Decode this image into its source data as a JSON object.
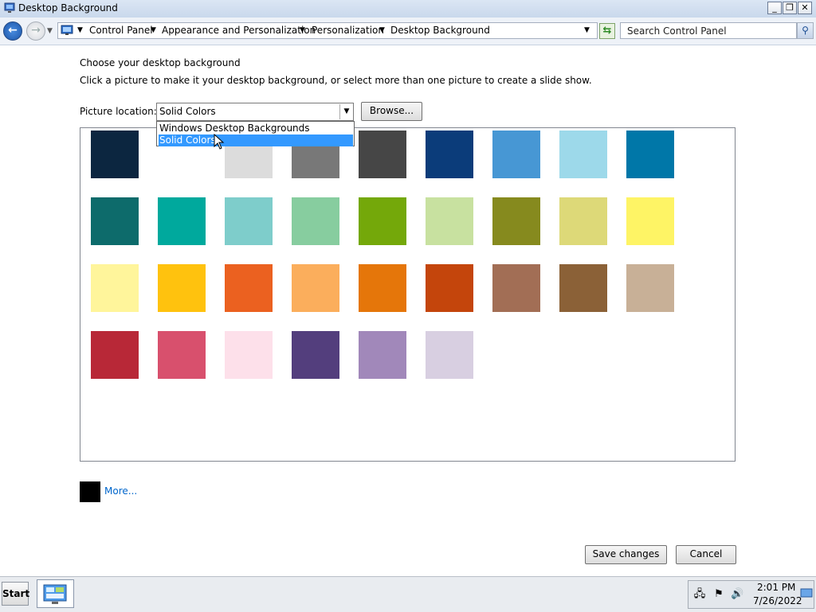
{
  "window": {
    "title": "Desktop Background",
    "controls": {
      "minimize": "_",
      "maximize": "❐",
      "close": "✕"
    }
  },
  "address": {
    "breadcrumbs": [
      "Control Panel",
      "Appearance and Personalization",
      "Personalization",
      "Desktop Background"
    ],
    "search_placeholder": "Search Control Panel"
  },
  "content": {
    "heading": "Choose your desktop background",
    "instruction": "Click a picture to make it your desktop background, or select more than one picture to create a slide show.",
    "location_label": "Picture location:",
    "location_value": "Solid Colors",
    "location_options": [
      "Windows Desktop Backgrounds",
      "Solid Colors"
    ],
    "selected_option": "Solid Colors",
    "browse_label": "Browse...",
    "more_link": "More...",
    "more_color": "#000000",
    "save_label": "Save changes",
    "cancel_label": "Cancel"
  },
  "swatches": [
    [
      "#0c2640",
      "#ffffff",
      "#dcdcdc",
      "#787878",
      "#464646",
      "#0b3c7a",
      "#4797d4",
      "#9dd9ea",
      "#0077a8"
    ],
    [
      "#0d6b6b",
      "#00a99d",
      "#7ecdcb",
      "#87cd9f",
      "#74a80a",
      "#c8e1a0",
      "#868a1e",
      "#ddd978",
      "#fef465"
    ],
    [
      "#fff59b",
      "#ffc20e",
      "#eb6120",
      "#fbae5c",
      "#e5760a",
      "#c4450c",
      "#a26e55",
      "#8b6137",
      "#c8b097"
    ],
    [
      "#b82837",
      "#d8506d",
      "#fde0ea",
      "#533e7d",
      "#a188ba",
      "#d8cfe1"
    ]
  ],
  "taskbar": {
    "start_label": "Start",
    "time": "2:01 PM",
    "date": "7/26/2022"
  },
  "colors": {
    "accent_selection": "#3399ff",
    "link": "#0066cc"
  }
}
